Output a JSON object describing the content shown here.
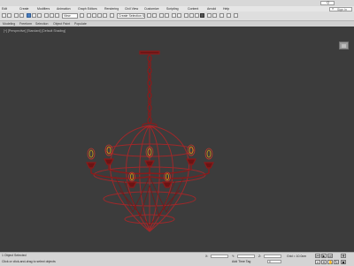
{
  "title_bar": {
    "search_label": "Q"
  },
  "menu": {
    "items": [
      "Edit",
      "Create",
      "Modifiers",
      "Animation",
      "Graph Editors",
      "Rendering",
      "Civil View",
      "Customize",
      "Scripting",
      "Content",
      "Arnold",
      "Help"
    ],
    "search_icon": "search-icon",
    "search_placeholder": "Sign In"
  },
  "toolbar": {
    "view_dropdown": "View",
    "selection_set": "Create Selection Set"
  },
  "ribbon": {
    "tabs": [
      "Modeling",
      "Freeform",
      "Selection",
      "Object Paint",
      "Populate"
    ]
  },
  "viewport": {
    "label": "[+] [Perspective] [Standard] [Default Shading]",
    "object_color": "#8b1a1a",
    "wire_color": "#c0392b",
    "bulb_color": "#d4a017"
  },
  "status": {
    "selected": "1 Object Selected",
    "hint": "Click or click-and-drag to select objects",
    "x_label": "X:",
    "y_label": "Y:",
    "z_label": "Z:",
    "grid": "Grid = 10.0cm",
    "add_time_tag": "Add Time Tag",
    "auto_key": "Auto Key",
    "set_key": "Set Key",
    "selected_dropdown": "Selected",
    "key_filters": "Key Filters...",
    "frame": "0"
  }
}
